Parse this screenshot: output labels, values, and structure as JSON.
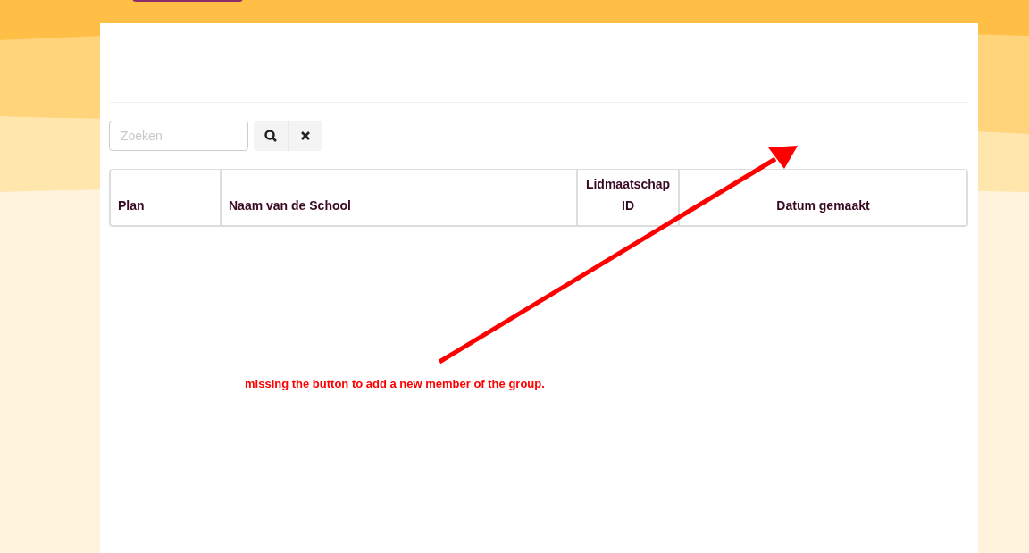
{
  "search": {
    "placeholder": "Zoeken"
  },
  "table": {
    "columns": [
      "Plan",
      "Naam van de School",
      "Lidmaatschap ID",
      "Datum gemaakt"
    ]
  },
  "annotation": {
    "text": "missing the button to add a new member of the group."
  }
}
